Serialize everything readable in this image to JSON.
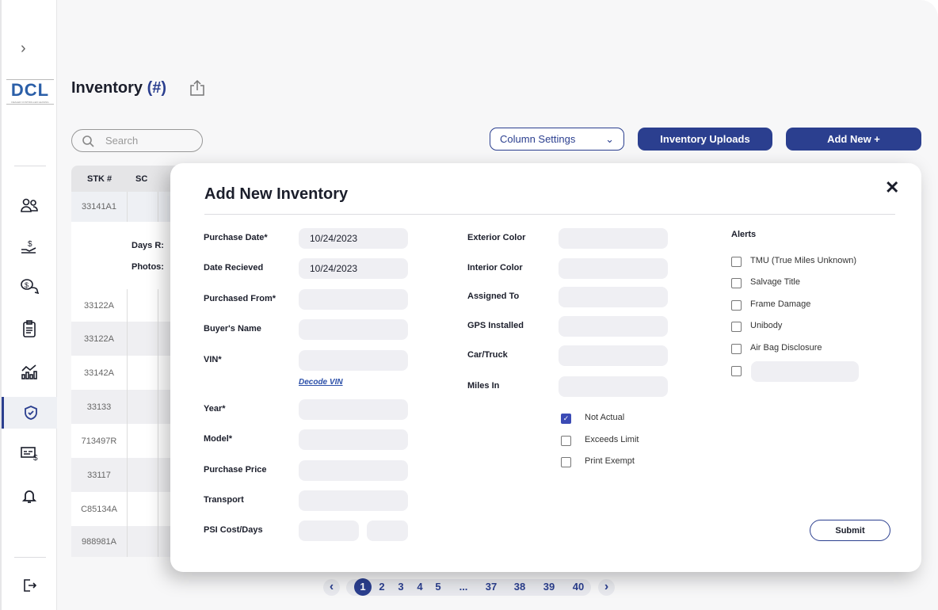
{
  "sidebar": {
    "logo": "DCL",
    "logo_sub": "DEALER CONTROLLED LEASING",
    "icons": [
      "people-icon",
      "hand-dollar-icon",
      "chat-dollar-icon",
      "clipboard-icon",
      "analytics-icon",
      "shield-check-icon",
      "invoice-dollar-icon",
      "bell-icon"
    ],
    "active": "shield-check-icon"
  },
  "header": {
    "title": "Inventory",
    "count": "(#)"
  },
  "toolbar": {
    "search_placeholder": "Search",
    "column_settings": "Column Settings",
    "inventory_uploads": "Inventory Uploads",
    "add_new": "Add New +"
  },
  "table": {
    "headers": [
      "STK #",
      "SC"
    ],
    "first_row": "33141A1",
    "expanded": {
      "days_label": "Days R:",
      "photos_label": "Photos:"
    },
    "rows": [
      "33122A",
      "33122A",
      "33142A",
      "33133",
      "713497R",
      "33117",
      "C85134A",
      "988981A"
    ]
  },
  "modal": {
    "title": "Add New Inventory",
    "left": [
      {
        "label": "Purchase Date*",
        "value": "10/24/2023"
      },
      {
        "label": "Date Recieved",
        "value": "10/24/2023"
      },
      {
        "label": "Purchased From*",
        "value": ""
      },
      {
        "label": "Buyer's Name",
        "value": ""
      },
      {
        "label": "VIN*",
        "value": ""
      },
      {
        "label": "Year*",
        "value": ""
      },
      {
        "label": "Model*",
        "value": ""
      },
      {
        "label": "Purchase Price",
        "value": ""
      },
      {
        "label": "Transport",
        "value": ""
      },
      {
        "label": "PSI Cost/Days",
        "value": ""
      }
    ],
    "decode_vin": "Decode VIN",
    "middle": [
      {
        "label": "Exterior Color",
        "value": ""
      },
      {
        "label": "Interior Color",
        "value": ""
      },
      {
        "label": "Assigned To",
        "value": ""
      },
      {
        "label": "GPS Installed",
        "value": ""
      },
      {
        "label": "Car/Truck",
        "value": ""
      },
      {
        "label": "Miles In",
        "value": ""
      }
    ],
    "miles_options": [
      {
        "label": "Not Actual",
        "checked": true
      },
      {
        "label": "Exceeds Limit",
        "checked": false
      },
      {
        "label": "Print Exempt",
        "checked": false
      }
    ],
    "alerts_title": "Alerts",
    "alerts": [
      {
        "label": "TMU (True Miles Unknown)",
        "checked": false
      },
      {
        "label": "Salvage Title",
        "checked": false
      },
      {
        "label": "Frame Damage",
        "checked": false
      },
      {
        "label": "Unibody",
        "checked": false
      },
      {
        "label": "Air Bag Disclosure",
        "checked": false
      }
    ],
    "submit": "Submit"
  },
  "pagination": {
    "current": "1",
    "pages": [
      "1",
      "2",
      "3",
      "4",
      "5",
      "...",
      "37",
      "38",
      "39",
      "40"
    ]
  }
}
